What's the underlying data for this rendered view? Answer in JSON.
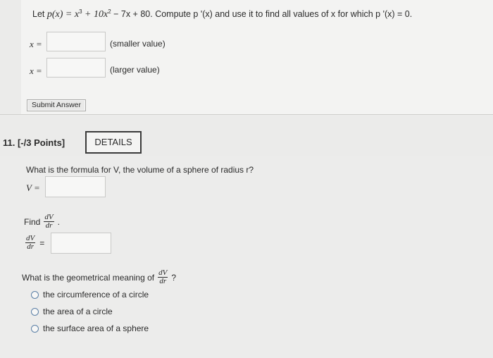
{
  "question10": {
    "prompt_prefix": "Let ",
    "px_expr": "p(x) = x",
    "exp3": "3",
    "plus10x": " + 10x",
    "exp2": "2",
    "rest": " − 7x + 80",
    "compute": ".  Compute p '(x) and use it to find all values of x for which p '(x) = 0.",
    "x_label_1": "x =",
    "x_label_2": "x =",
    "hint_smaller": "(smaller value)",
    "hint_larger": "(larger value)",
    "submit_label": "Submit Answer",
    "answer_1": "",
    "answer_2": ""
  },
  "question11": {
    "number": "11.  [-/3 Points]",
    "details_label": "DETAILS",
    "formula_prompt": "What is the formula for V, the volume of a sphere of radius r?",
    "v_label": "V =",
    "find_label": "Find",
    "dv": "dV",
    "dr": "dr",
    "equals": "=",
    "meaning_prompt": "What is the geometrical meaning of",
    "question_mark": "?",
    "options": [
      "the circumference of a circle",
      "the area of a circle",
      "the surface area of a sphere"
    ],
    "answer_v": "",
    "answer_dvdr": ""
  }
}
